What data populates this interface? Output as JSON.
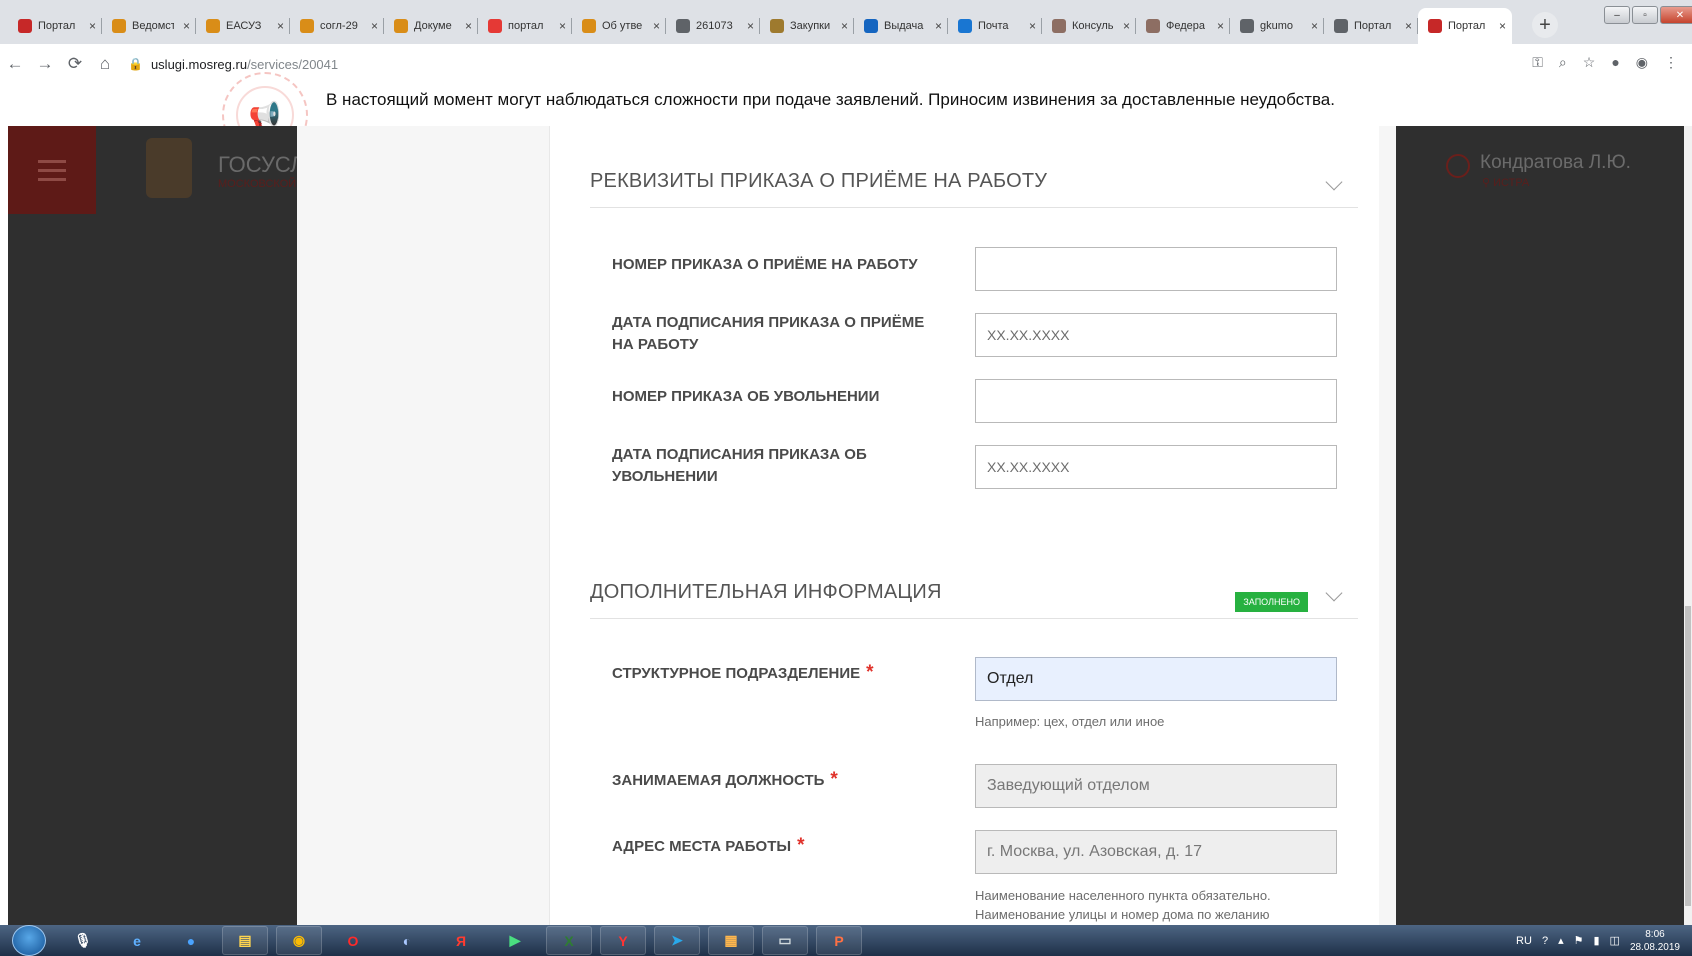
{
  "browser": {
    "tabs": [
      {
        "title": "Портал",
        "favicon_color": "#c62828"
      },
      {
        "title": "Ведомст",
        "favicon_color": "#d98d18"
      },
      {
        "title": "ЕАСУЗ",
        "favicon_color": "#d98d18"
      },
      {
        "title": "согл-29",
        "favicon_color": "#d98d18"
      },
      {
        "title": "Докуме",
        "favicon_color": "#d98d18"
      },
      {
        "title": "портал",
        "favicon_color": "#e53935"
      },
      {
        "title": "Об утве",
        "favicon_color": "#d98d18"
      },
      {
        "title": "261073",
        "favicon_color": "#5f6368"
      },
      {
        "title": "Закупки",
        "favicon_color": "#9e7a2e"
      },
      {
        "title": "Выдача",
        "favicon_color": "#1565c0"
      },
      {
        "title": "Почта",
        "favicon_color": "#1976d2"
      },
      {
        "title": "Консуль",
        "favicon_color": "#8d6e63"
      },
      {
        "title": "Федера",
        "favicon_color": "#8d6e63"
      },
      {
        "title": "gkumo",
        "favicon_color": "#5f6368"
      },
      {
        "title": "Портал",
        "favicon_color": "#5f6368"
      },
      {
        "title": "Портал",
        "favicon_color": "#c62828",
        "active": true
      }
    ],
    "url_host": "uslugi.mosreg.ru",
    "url_path": "/services/20041"
  },
  "notice": {
    "text": "В настоящий момент могут наблюдаться сложности при подаче заявлений. Приносим извинения за доставленные неудобства."
  },
  "site": {
    "title": "ГОСУСЛ",
    "subtitle": "МОСКОВСКОЙ",
    "user_name": "Кондратова Л.Ю.",
    "user_location": "ИСТРА"
  },
  "form": {
    "section_order": {
      "title": "РЕКВИЗИТЫ ПРИКАЗА О ПРИЁМЕ НА РАБОТУ",
      "fields": {
        "hire_order_number": {
          "label": "НОМЕР ПРИКАЗА О ПРИЁМЕ НА РАБОТУ",
          "value": ""
        },
        "hire_order_date": {
          "label": "ДАТА ПОДПИСАНИЯ ПРИКАЗА О ПРИЁМЕ НА РАБОТУ",
          "placeholder": "XX.XX.XXXX"
        },
        "dismissal_order_number": {
          "label": "НОМЕР ПРИКАЗА ОБ УВОЛЬНЕНИИ",
          "value": ""
        },
        "dismissal_order_date": {
          "label": "ДАТА ПОДПИСАНИЯ ПРИКАЗА ОБ УВОЛЬНЕНИИ",
          "placeholder": "XX.XX.XXXX"
        }
      }
    },
    "section_additional": {
      "title": "ДОПОЛНИТЕЛЬНАЯ ИНФОРМАЦИЯ",
      "badge": "ЗАПОЛНЕНО",
      "fields": {
        "department": {
          "label": "СТРУКТУРНОЕ ПОДРАЗДЕЛЕНИЕ",
          "value": "Отдел",
          "hint": "Например: цех, отдел или иное"
        },
        "position": {
          "label": "ЗАНИМАЕМАЯ ДОЛЖНОСТЬ",
          "placeholder": "Заведующий отделом"
        },
        "work_address": {
          "label": "АДРЕС МЕСТА РАБОТЫ",
          "placeholder": "г. Москва, ул. Азовская, д. 17",
          "hint_line1": "Наименование населенного пункта обязательно.",
          "hint_line2": "Наименование улицы и номер дома по желанию"
        }
      }
    },
    "required_mark": "*"
  },
  "taskbar": {
    "language": "RU",
    "time": "8:06",
    "date": "28.08.2019"
  }
}
